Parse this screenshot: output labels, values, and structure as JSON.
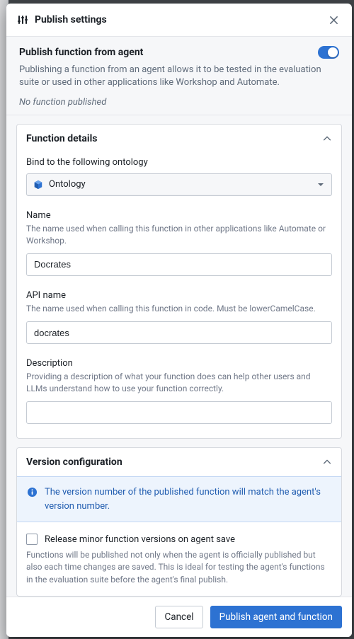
{
  "modal": {
    "title": "Publish settings"
  },
  "intro": {
    "title": "Publish function from agent",
    "description": "Publishing a function from an agent allows it to be tested in the evaluation suite or used in other applications like Workshop and Automate.",
    "none_published": "No function published",
    "toggle_on": true
  },
  "details": {
    "section_title": "Function details",
    "ontology_label": "Bind to the following ontology",
    "ontology_selected": "Ontology",
    "name_label": "Name",
    "name_help": "The name used when calling this function in other applications like Automate or Workshop.",
    "name_value": "Docrates",
    "api_label": "API name",
    "api_help": "The name used when calling this function in code. Must be lowerCamelCase.",
    "api_value": "docrates",
    "desc_label": "Description",
    "desc_help": "Providing a description of what your function does can help other users and LLMs understand how to use your function correctly.",
    "desc_value": ""
  },
  "version": {
    "section_title": "Version configuration",
    "info_text": "The version number of the published function will match the agent's version number.",
    "release_minor_label": "Release minor function versions on agent save",
    "release_minor_help": "Functions will be published not only when the agent is officially published but also each time changes are saved. This is ideal for testing the agent's functions in the evaluation suite before the agent's final publish.",
    "release_minor_checked": false
  },
  "footer": {
    "cancel": "Cancel",
    "publish": "Publish agent and function"
  },
  "icons": {
    "settings": "settings-icon",
    "close": "close-icon",
    "cube": "cube-icon",
    "chevron_up": "chevron-up-icon",
    "caret_down": "caret-down-icon",
    "info": "info-icon"
  }
}
